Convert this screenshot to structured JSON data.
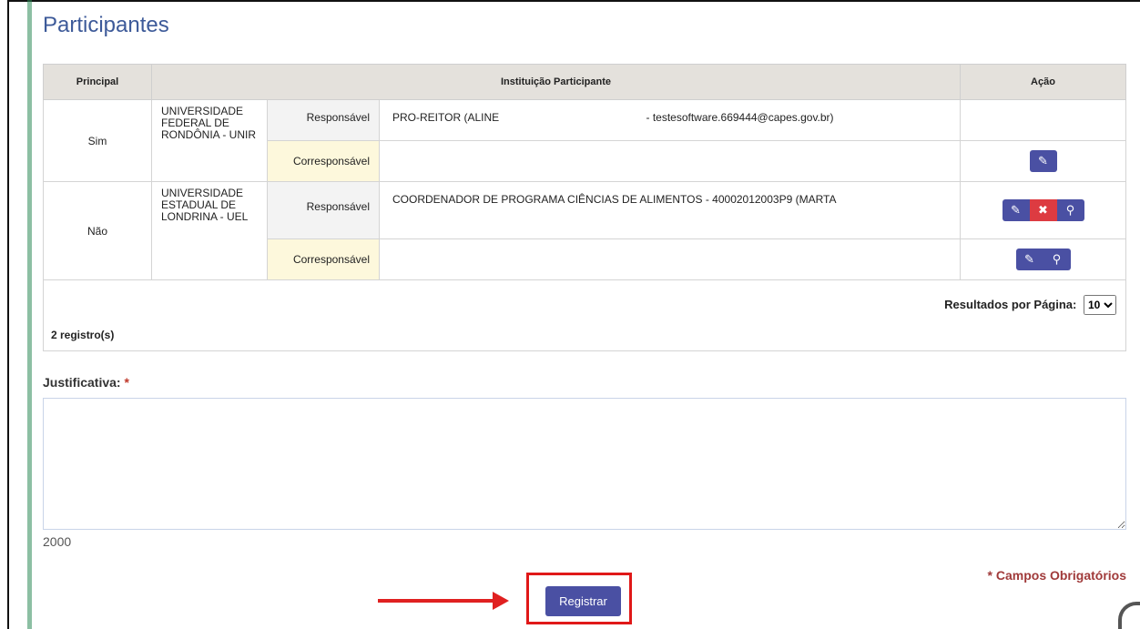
{
  "page": {
    "title": "Participantes"
  },
  "table": {
    "headers": {
      "principal": "Principal",
      "instituicao": "Instituição Participante",
      "acao": "Ação"
    },
    "rows": [
      {
        "principal": "Sim",
        "institution": "UNIVERSIDADE FEDERAL DE RONDÔNIA - UNIR",
        "responsavel_label": "Responsável",
        "responsavel_name": "PRO-REITOR (ALINE",
        "responsavel_email": "- testesoftware.669444@capes.gov.br)",
        "corresponsavel_label": "Corresponsável"
      },
      {
        "principal": "Não",
        "institution": "UNIVERSIDADE ESTADUAL DE LONDRINA - UEL",
        "responsavel_label": "Responsável",
        "responsavel_name": "COORDENADOR DE PROGRAMA CIÊNCIAS DE ALIMENTOS - 40002012003P9 (MARTA",
        "corresponsavel_label": "Corresponsável"
      }
    ],
    "results_per_page_label": "Resultados por Página:",
    "results_per_page_value": "10",
    "record_count": "2 registro(s)"
  },
  "form": {
    "justificativa_label": "Justificativa:",
    "required_mark": "*",
    "char_counter": "2000",
    "mandatory_note": "* Campos Obrigatórios",
    "submit_label": "Registrar"
  },
  "colors": {
    "accent": "#4a50a3",
    "danger": "#dd3b41",
    "highlight": "#e01818"
  },
  "icons": {
    "edit": "edit-icon",
    "delete": "close-icon",
    "view": "search-icon"
  }
}
